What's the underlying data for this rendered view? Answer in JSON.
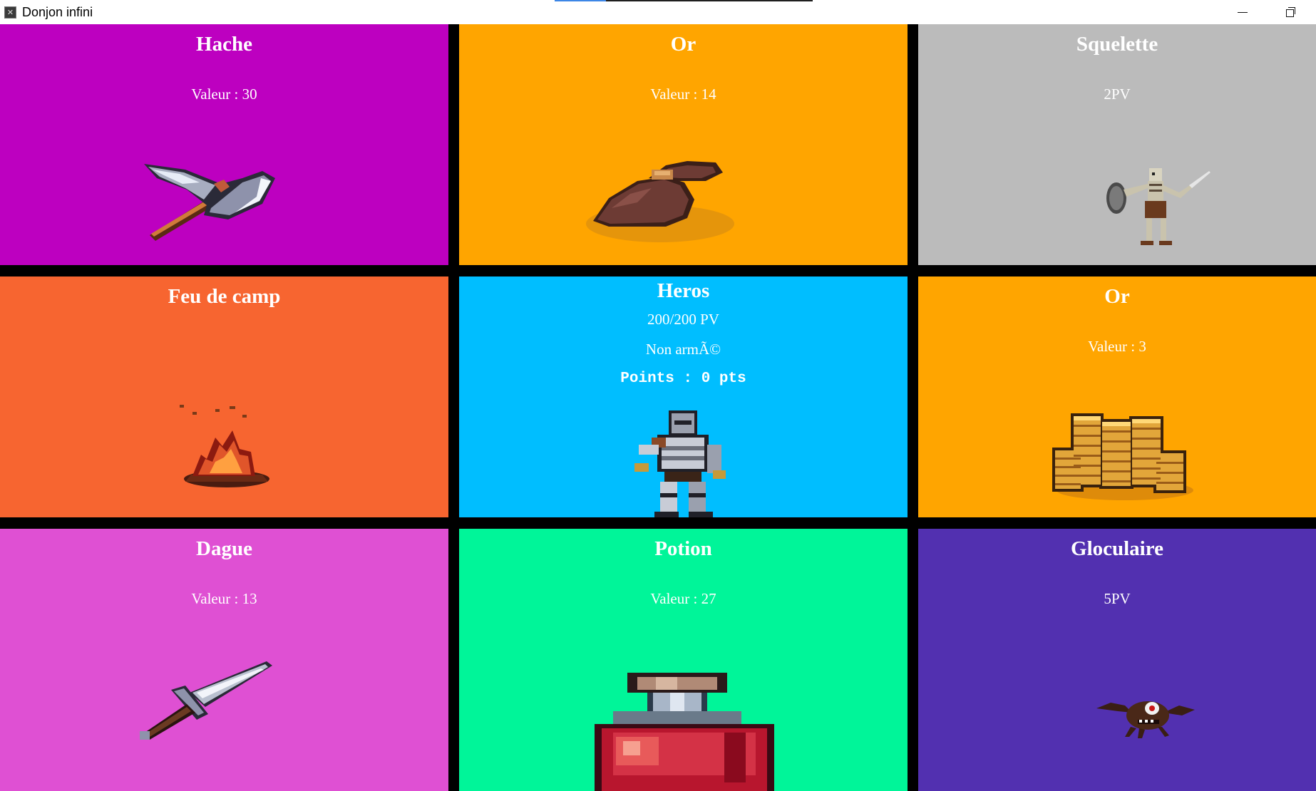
{
  "window": {
    "title": "Donjon infini",
    "app_icon": "sword-cross-icon",
    "loading_progress": 0.2,
    "controls": [
      "minimize-icon",
      "restore-icon"
    ]
  },
  "colors": {
    "magenta": "#BD00C0",
    "amber": "#FFA500",
    "silver": "#BBBBBB",
    "orange_red": "#F76530",
    "sky": "#00BEFF",
    "orchid": "#DF50D3",
    "spring_green": "#00F599",
    "indigo": "#5230B0"
  },
  "cards": [
    {
      "title": "Hache",
      "line": "Valeur : 30",
      "icon": "axe-icon"
    },
    {
      "title": "Or",
      "line": "Valeur : 14",
      "icon": "gold-bag-icon"
    },
    {
      "title": "Squelette",
      "line": "2PV",
      "icon": "skeleton-icon"
    },
    {
      "title": "Feu de camp",
      "line": "",
      "icon": "campfire-icon"
    },
    {
      "title": "Heros",
      "hp": "200/200 PV",
      "weapon": "Non armÃ©",
      "points": "Points : 0 pts",
      "icon": "knight-icon"
    },
    {
      "title": "Or",
      "line": "Valeur : 3",
      "icon": "gold-coins-icon"
    },
    {
      "title": "Dague",
      "line": "Valeur : 13",
      "icon": "dagger-icon"
    },
    {
      "title": "Potion",
      "line": "Valeur : 27",
      "icon": "potion-icon"
    },
    {
      "title": "Gloculaire",
      "line": "5PV",
      "icon": "eye-monster-icon"
    }
  ]
}
